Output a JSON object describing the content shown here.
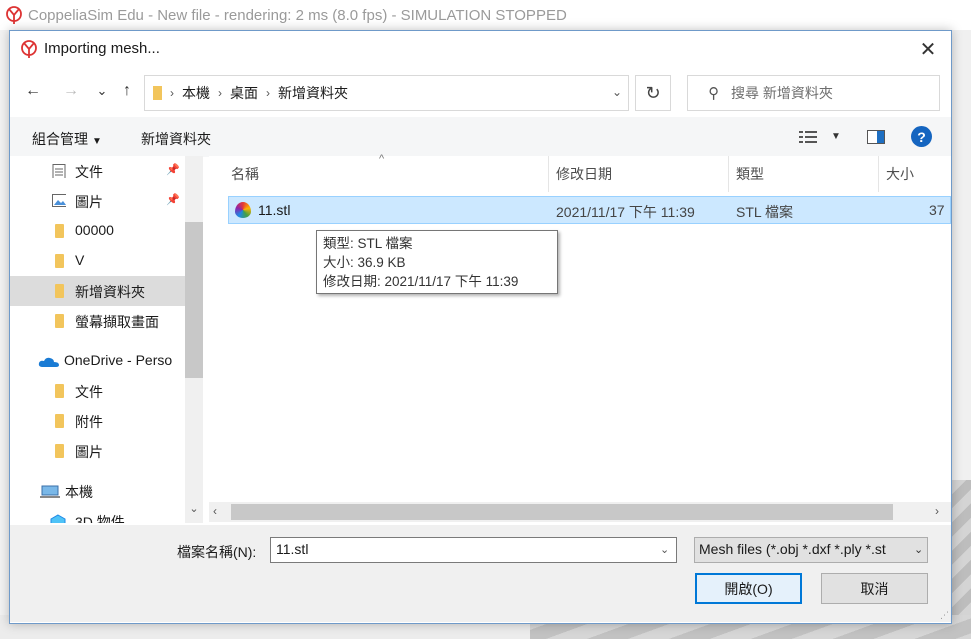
{
  "background_app": {
    "title": "CoppeliaSim Edu - New file - rendering: 2 ms (8.0 fps) - SIMULATION STOPPED"
  },
  "dialog": {
    "title": "Importing mesh...",
    "close_label": "✕"
  },
  "navbar": {
    "back": "←",
    "forward": "→",
    "recent": "⌄",
    "up": "↑",
    "breadcrumbs": [
      "本機",
      "桌面",
      "新增資料夾"
    ],
    "refresh": "↻",
    "search_placeholder": "搜尋 新增資料夾"
  },
  "commandbar": {
    "organize": "組合管理",
    "new_folder": "新增資料夾",
    "help": "?"
  },
  "leftnav": {
    "items": [
      {
        "label": "文件",
        "icon": "document-icon",
        "pinned": true
      },
      {
        "label": "圖片",
        "icon": "picture-icon",
        "pinned": true
      },
      {
        "label": "00000",
        "icon": "folder-icon",
        "pinned": false
      },
      {
        "label": "V",
        "icon": "folder-icon",
        "pinned": false
      },
      {
        "label": "新增資料夾",
        "icon": "folder-icon",
        "pinned": false,
        "selected": true
      },
      {
        "label": "螢幕擷取畫面",
        "icon": "folder-icon",
        "pinned": false
      },
      {
        "label": "OneDrive - Perso",
        "icon": "onedrive-icon",
        "pinned": false
      },
      {
        "label": "文件",
        "icon": "folder-icon",
        "pinned": false
      },
      {
        "label": "附件",
        "icon": "folder-icon",
        "pinned": false
      },
      {
        "label": "圖片",
        "icon": "folder-icon",
        "pinned": false
      },
      {
        "label": "本機",
        "icon": "computer-icon",
        "pinned": false
      },
      {
        "label": "3D 物件",
        "icon": "3d-objects-icon",
        "pinned": false
      }
    ]
  },
  "filelist": {
    "columns": [
      "名稱",
      "修改日期",
      "類型",
      "大小"
    ],
    "rows": [
      {
        "name": "11.stl",
        "modified": "2021/11/17 下午 11:39",
        "type": "STL 檔案",
        "size": "37"
      }
    ]
  },
  "tooltip": {
    "type_line": "類型: STL 檔案",
    "size_line": "大小: 36.9 KB",
    "date_line": "修改日期: 2021/11/17 下午 11:39"
  },
  "bottom": {
    "filename_label": "檔案名稱(N):",
    "filename_value": "11.stl",
    "filter": "Mesh files (*.obj *.dxf *.ply *.st",
    "open_label": "開啟(O)",
    "cancel_label": "取消"
  },
  "colors": {
    "selection": "#cce8ff",
    "accent": "#0078d7",
    "help": "#1565c0",
    "folder": "#f2c55c"
  }
}
